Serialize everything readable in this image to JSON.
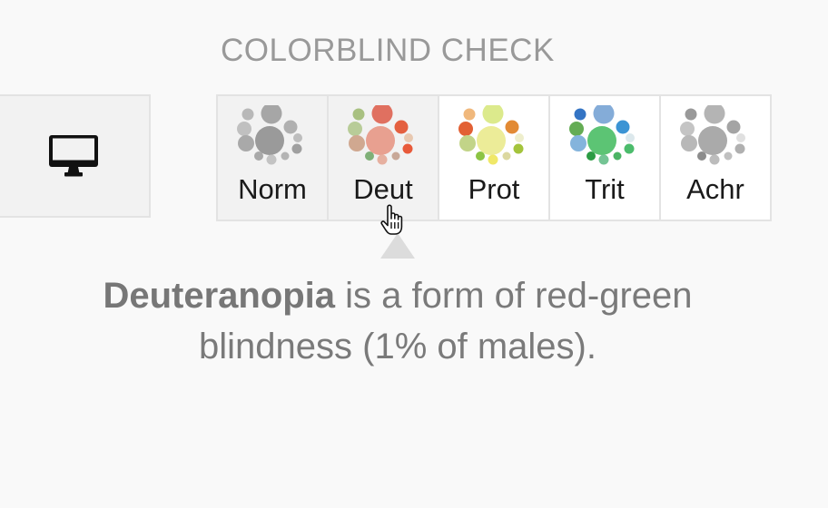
{
  "section": {
    "title": "COLORBLIND CHECK"
  },
  "device_button": {
    "icon": "desktop-monitor-icon"
  },
  "tabs": [
    {
      "label": "Norm",
      "selected_look": true,
      "colors": {
        "big": "#9a9a9a",
        "top1": "#b8b8b8",
        "top2": "#a6a6a6",
        "left1": "#c0c0c0",
        "left2": "#a9a9a9",
        "right1": "#b0b0b0",
        "right2": "#bdbdbd",
        "bottom1": "#a8a8a8",
        "bottom2": "#c3c3c3",
        "bottom3": "#b4b4b4",
        "small1": "#a0a0a0"
      }
    },
    {
      "label": "Deut",
      "selected_look": true,
      "colors": {
        "big": "#e8a090",
        "top1": "#a8c080",
        "top2": "#e07060",
        "left1": "#b8cc98",
        "left2": "#d0a890",
        "right1": "#e46040",
        "right2": "#e8c8b0",
        "bottom1": "#7fb078",
        "bottom2": "#e6b0a0",
        "bottom3": "#c8a898",
        "small1": "#e85a3a"
      }
    },
    {
      "label": "Prot",
      "selected_look": false,
      "colors": {
        "big": "#ecec98",
        "top1": "#f0b87c",
        "top2": "#dcea8c",
        "left1": "#e26034",
        "left2": "#c2d488",
        "right1": "#e28a34",
        "right2": "#eeeecc",
        "bottom1": "#8cc444",
        "bottom2": "#f0e868",
        "bottom3": "#dcd8a0",
        "small1": "#a4c43c"
      }
    },
    {
      "label": "Trit",
      "selected_look": false,
      "colors": {
        "big": "#5cc474",
        "top1": "#3474c4",
        "top2": "#84acd8",
        "left1": "#64ac54",
        "left2": "#84b4dc",
        "right1": "#3c94d4",
        "right2": "#dce8ec",
        "bottom1": "#2c9c44",
        "bottom2": "#74c494",
        "bottom3": "#4cb464",
        "small1": "#4cbc6c"
      }
    },
    {
      "label": "Achr",
      "selected_look": false,
      "colors": {
        "big": "#aaaaaa",
        "top1": "#999999",
        "top2": "#b4b4b4",
        "left1": "#c4c4c4",
        "left2": "#b8b8b8",
        "right1": "#a4a4a4",
        "right2": "#e0e0e0",
        "bottom1": "#8c8c8c",
        "bottom2": "#bcbcbc",
        "bottom3": "#c0c0c0",
        "small1": "#b0b0b0"
      }
    }
  ],
  "description": {
    "term": "Deuteranopia",
    "text": " is a form of red-green blindness (1% of males)."
  },
  "cursor": {
    "icon": "hand-pointer-icon"
  }
}
